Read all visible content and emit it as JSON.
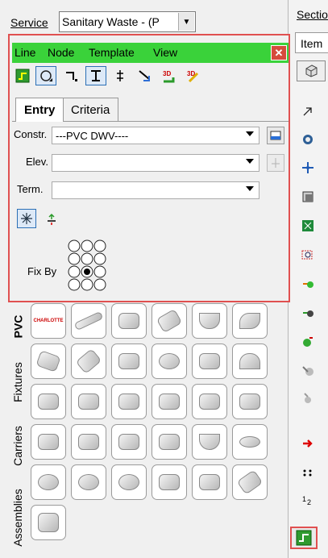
{
  "service": {
    "label": "Service",
    "value": "Sanitary Waste - (P"
  },
  "right_panel": {
    "section_label": "Sectio",
    "tab_label": "Item"
  },
  "float": {
    "menu": [
      "Line",
      "Node",
      "Template",
      "View"
    ],
    "tabs": [
      "Entry",
      "Criteria"
    ],
    "fields": {
      "constr_label": "Constr.",
      "constr_value": "---PVC DWV----",
      "elev_label": "Elev.",
      "term_label": "Term.",
      "fixby_label": "Fix By"
    }
  },
  "palette": {
    "tabs": [
      "PVC",
      "Fixtures",
      "Carriers",
      "Assemblies"
    ],
    "brand_text": "CHARLOTTE"
  },
  "colors": {
    "accent_green": "#3ad23a",
    "highlight_red": "#e05050",
    "close_red": "#d64b3c"
  }
}
